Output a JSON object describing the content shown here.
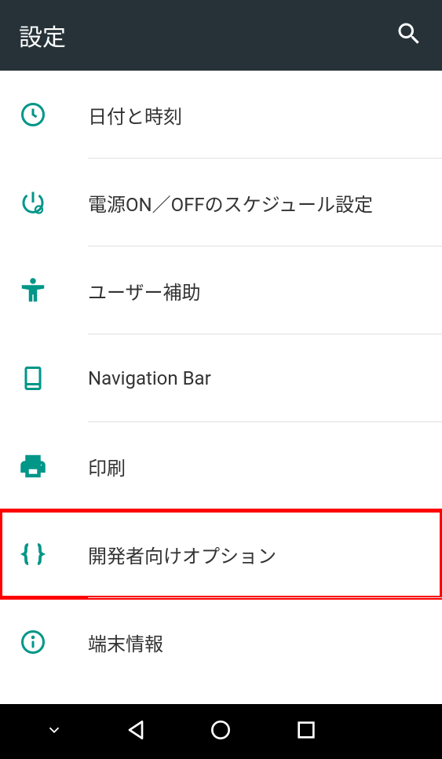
{
  "appbar": {
    "title": "設定"
  },
  "items": [
    {
      "label": "日付と時刻",
      "icon": "clock-icon"
    },
    {
      "label": "電源ON／OFFのスケジュール設定",
      "icon": "power-schedule-icon"
    },
    {
      "label": "ユーザー補助",
      "icon": "accessibility-icon"
    },
    {
      "label": "Navigation Bar",
      "icon": "tablet-icon"
    },
    {
      "label": "印刷",
      "icon": "printer-icon"
    },
    {
      "label": "開発者向けオプション",
      "icon": "braces-icon",
      "highlighted": true
    },
    {
      "label": "端末情報",
      "icon": "info-icon"
    }
  ],
  "accent": "#009688"
}
